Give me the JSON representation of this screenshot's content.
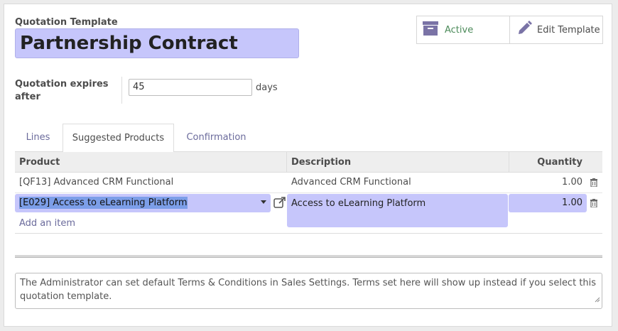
{
  "form": {
    "template_label": "Quotation Template",
    "template_name": "Partnership Contract",
    "expires_label": "Quotation expires after",
    "expires_value": "45",
    "days_label": "days"
  },
  "buttons": {
    "active_label": "Active",
    "edit_label": "Edit Template",
    "active_icon": "archive-icon",
    "edit_icon": "pencil-icon"
  },
  "tabs": [
    {
      "label": "Lines"
    },
    {
      "label": "Suggested Products",
      "active": true
    },
    {
      "label": "Confirmation"
    }
  ],
  "table": {
    "headers": {
      "product": "Product",
      "description": "Description",
      "quantity": "Quantity"
    },
    "rows": [
      {
        "product": "[QF13] Advanced CRM Functional",
        "description": "Advanced CRM Functional",
        "quantity": "1.00"
      }
    ],
    "editing_row": {
      "product": "[E029] Access to eLearning Platform",
      "description": "Access to eLearning Platform",
      "quantity": "1.00"
    },
    "add_item_label": "Add an item"
  },
  "notes_placeholder": "The Administrator can set default Terms & Conditions in Sales Settings. Terms set here will show up instead if you select this quotation template.",
  "colors": {
    "accent": "#c6c6fb",
    "link": "#6b6b9c",
    "active_green": "#4c8b5a"
  }
}
